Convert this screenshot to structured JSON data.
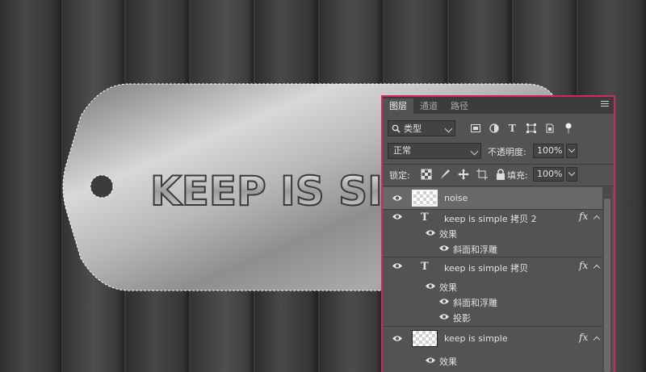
{
  "panel": {
    "tabs": [
      "图层",
      "通道",
      "路径"
    ],
    "filter_kind": "类型",
    "blend_mode": "正常",
    "opacity_label": "不透明度:",
    "opacity_value": "100%",
    "lock_label": "锁定:",
    "fill_label": "填充:",
    "fill_value": "100%"
  },
  "canvas_text": "KEEP IS SIMPLE",
  "layers": [
    {
      "name": "noise",
      "kind": "pixel",
      "selected": true
    },
    {
      "name": "keep is simple  拷贝 2",
      "kind": "text",
      "fx": "fx",
      "effects_label": "效果",
      "effects": [
        "斜面和浮雕"
      ]
    },
    {
      "name": "keep is simple  拷贝",
      "kind": "text",
      "fx": "fx",
      "effects_label": "效果",
      "effects": [
        "斜面和浮雕",
        "投影"
      ]
    },
    {
      "name": "keep is simple",
      "kind": "pixel",
      "fx": "fx",
      "effects_label": "效果",
      "effects": []
    }
  ],
  "colors": {
    "panel_border": "#d1266f",
    "panel_bg": "#535353",
    "selected_row": "#696969"
  }
}
